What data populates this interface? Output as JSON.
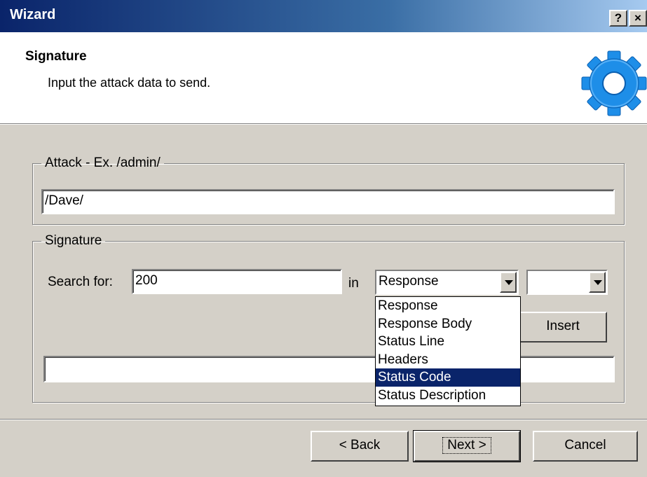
{
  "window": {
    "title": "Wizard",
    "help_label": "?",
    "close_label": "×"
  },
  "header": {
    "title": "Signature",
    "subtitle": "Input the attack data to send.",
    "icon": "gear-icon",
    "icon_color": "#1e8ee8"
  },
  "attack_group": {
    "legend": "Attack - Ex. /admin/",
    "value": "/Dave/"
  },
  "signature_group": {
    "legend": "Signature",
    "search_label": "Search for:",
    "search_value": "200",
    "in_label": "in",
    "location_selected": "Response",
    "operator_selected": "",
    "insert_button": "Insert",
    "signature_value": ""
  },
  "dropdown": {
    "options": [
      "Response",
      "Response Body",
      "Status Line",
      "Headers",
      "Status Code",
      "Status Description"
    ],
    "highlighted": "Status Code",
    "highlight_color": "#0a246a"
  },
  "footer": {
    "back_label": "< Back",
    "next_label": "Next >",
    "cancel_label": "Cancel"
  }
}
